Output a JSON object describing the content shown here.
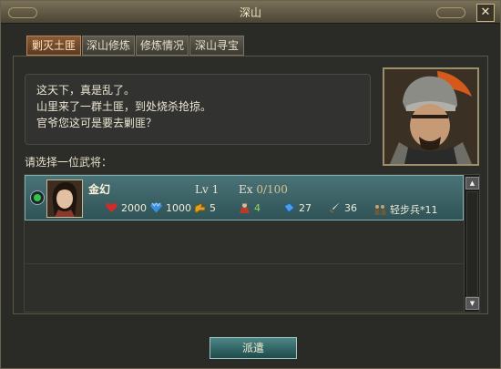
{
  "window": {
    "title": "深山",
    "close_label": "✕"
  },
  "tabs": [
    {
      "label": "剿灭土匪",
      "active": true
    },
    {
      "label": "深山修炼",
      "active": false
    },
    {
      "label": "修炼情况",
      "active": false
    },
    {
      "label": "深山寻宝",
      "active": false
    }
  ],
  "dialog": {
    "line1": "这天下，真是乱了。",
    "line2": "山里来了一群土匪，到处烧杀抢掠。",
    "line3": "官爷您这可是要去剿匪？"
  },
  "prompt": "请选择一位武将：",
  "generals": [
    {
      "name": "金幻",
      "lv_label": "Lv 1",
      "ex_label": "Ex",
      "ex_value": "0/100",
      "hp": "2000",
      "mp": "1000",
      "strength": "5",
      "command": "4",
      "defense": "27",
      "agility": "36",
      "troops": "轻步兵*11",
      "selected": true
    }
  ],
  "buttons": {
    "dispatch": "派遣"
  },
  "icons": {
    "hp": "heart-icon",
    "mp": "gem-icon",
    "strength": "arm-icon",
    "command": "soldier-icon",
    "defense": "book-icon",
    "agility": "sword-icon",
    "troops": "troops-icon"
  },
  "colors": {
    "selected_row": "#3c6669",
    "active_tab": "#7a4e2e",
    "heart": "#d42a2a",
    "gem": "#3a8fe0"
  }
}
